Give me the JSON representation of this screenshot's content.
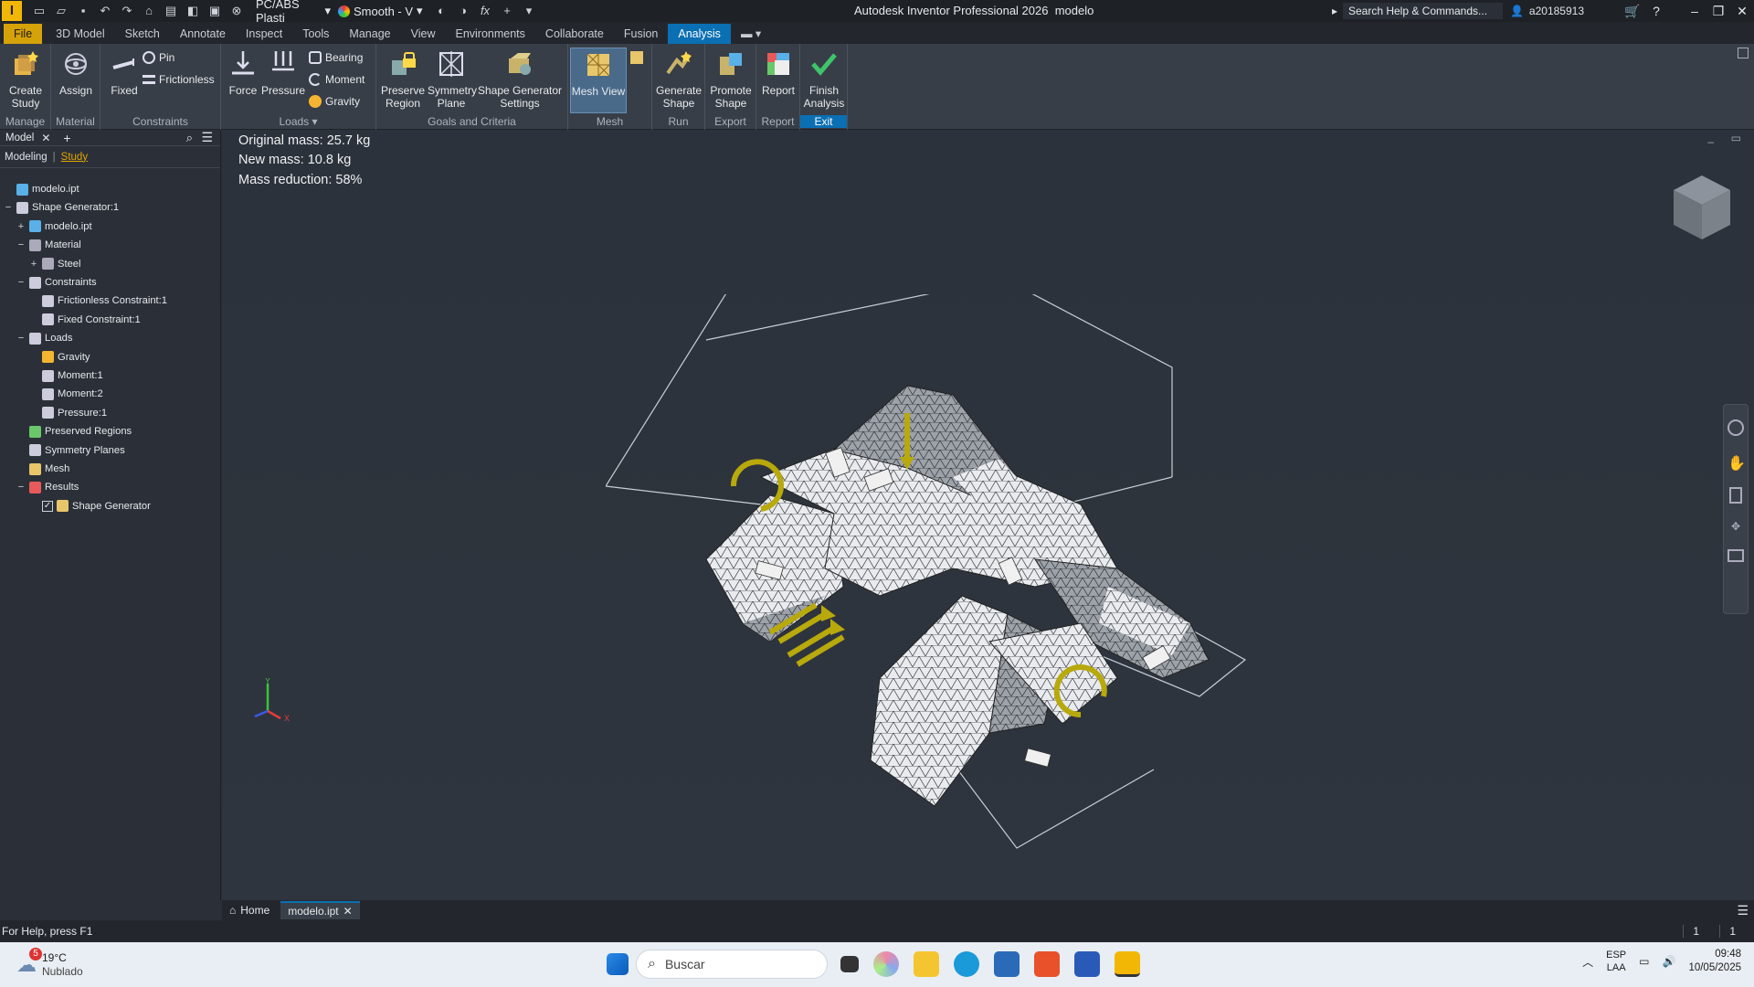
{
  "titlebar": {
    "material": "PC/ABS Plasti",
    "appearance": "Smooth - V",
    "app_title": "Autodesk Inventor Professional 2026",
    "doc_title": "modelo",
    "search_placeholder": "Search Help & Commands...",
    "user": "a20185913"
  },
  "tabs": [
    "File",
    "3D Model",
    "Sketch",
    "Annotate",
    "Inspect",
    "Tools",
    "Manage",
    "View",
    "Environments",
    "Collaborate",
    "Fusion",
    "Analysis"
  ],
  "active_tab": "Analysis",
  "ribbon": {
    "manage": {
      "label": "Manage",
      "create_study": "Create\nStudy"
    },
    "material": {
      "label": "Material",
      "assign": "Assign"
    },
    "constraints": {
      "label": "Constraints",
      "fixed": "Fixed",
      "pin": "Pin",
      "frictionless": "Frictionless"
    },
    "loads": {
      "label": "Loads",
      "force": "Force",
      "pressure": "Pressure",
      "bearing": "Bearing",
      "moment": "Moment",
      "gravity": "Gravity"
    },
    "goals": {
      "label": "Goals and Criteria",
      "preserve": "Preserve\nRegion",
      "symmetry": "Symmetry\nPlane",
      "settings": "Shape Generator\nSettings"
    },
    "mesh": {
      "label": "Mesh",
      "mesh_view": "Mesh View"
    },
    "run": {
      "label": "Run",
      "generate": "Generate\nShape"
    },
    "export": {
      "label": "Export",
      "promote": "Promote\nShape"
    },
    "report": {
      "label": "Report",
      "report": "Report"
    },
    "exit": {
      "label": "Exit",
      "finish": "Finish\nAnalysis"
    }
  },
  "browser": {
    "tab": "Model",
    "modeling": "Modeling",
    "study": "Study",
    "nodes": [
      {
        "label": "modelo.ipt",
        "level": 0,
        "exp": ""
      },
      {
        "label": "Shape Generator:1",
        "level": 0,
        "exp": "−"
      },
      {
        "label": "modelo.ipt",
        "level": 1,
        "exp": "+"
      },
      {
        "label": "Material",
        "level": 1,
        "exp": "−"
      },
      {
        "label": "Steel",
        "level": 2,
        "exp": "+"
      },
      {
        "label": "Constraints",
        "level": 1,
        "exp": "−"
      },
      {
        "label": "Frictionless Constraint:1",
        "level": 2,
        "exp": ""
      },
      {
        "label": "Fixed Constraint:1",
        "level": 2,
        "exp": ""
      },
      {
        "label": "Loads",
        "level": 1,
        "exp": "−"
      },
      {
        "label": "Gravity",
        "level": 2,
        "exp": ""
      },
      {
        "label": "Moment:1",
        "level": 2,
        "exp": ""
      },
      {
        "label": "Moment:2",
        "level": 2,
        "exp": ""
      },
      {
        "label": "Pressure:1",
        "level": 2,
        "exp": ""
      },
      {
        "label": "Preserved Regions",
        "level": 1,
        "exp": ""
      },
      {
        "label": "Symmetry Planes",
        "level": 1,
        "exp": ""
      },
      {
        "label": "Mesh",
        "level": 1,
        "exp": ""
      },
      {
        "label": "Results",
        "level": 1,
        "exp": "−"
      },
      {
        "label": "Shape Generator",
        "level": 2,
        "exp": "",
        "checkbox": true
      }
    ]
  },
  "viewport": {
    "original_mass": "Original mass: 25.7 kg",
    "new_mass": "New mass: 10.8 kg",
    "mass_reduction": "Mass reduction: 58%"
  },
  "doctabs": {
    "home": "Home",
    "doc": "modelo.ipt"
  },
  "status": {
    "help": "For Help, press F1",
    "n1": "1",
    "n2": "1"
  },
  "taskbar": {
    "temp": "19°C",
    "weather": "Nublado",
    "badge": "5",
    "search": "Buscar",
    "lang1": "ESP",
    "lang2": "LAA",
    "time": "09:48",
    "date": "10/05/2025"
  },
  "colors": {
    "accent": "#0a6fb3",
    "file_tab": "#d6a20a",
    "load_arrows": "#b8a90c"
  }
}
